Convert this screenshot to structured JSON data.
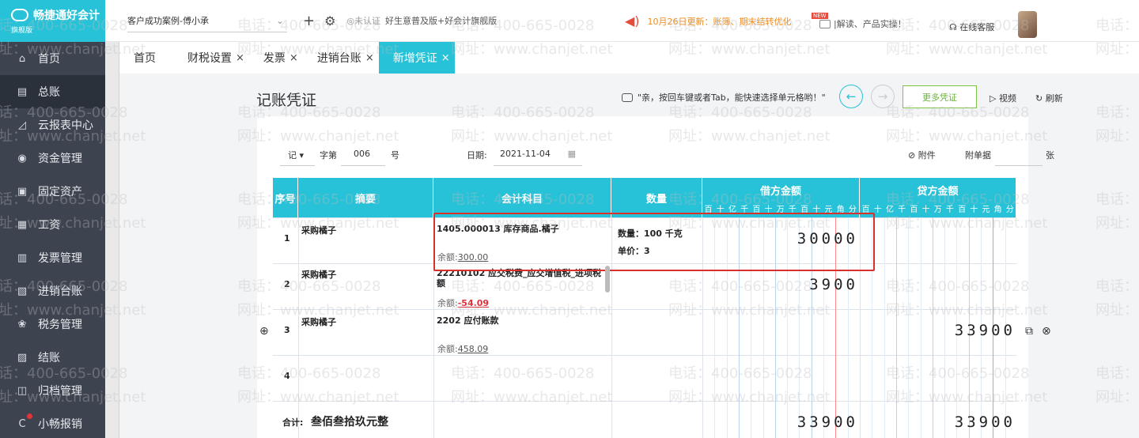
{
  "app": {
    "logo_text": "畅捷通好会计",
    "logo_sub": "旗舰版"
  },
  "sidebar": {
    "items": [
      {
        "label": "首页",
        "icon": "home-icon",
        "glyph": "⌂"
      },
      {
        "label": "总账",
        "icon": "ledger-icon",
        "glyph": "▤"
      },
      {
        "label": "云报表中心",
        "icon": "chart-icon",
        "glyph": "◿"
      },
      {
        "label": "资金管理",
        "icon": "money-bag-icon",
        "glyph": "◉"
      },
      {
        "label": "固定资产",
        "icon": "asset-icon",
        "glyph": "▣"
      },
      {
        "label": "工资",
        "icon": "salary-icon",
        "glyph": "▦"
      },
      {
        "label": "发票管理",
        "icon": "invoice-icon",
        "glyph": "▥"
      },
      {
        "label": "进销台账",
        "icon": "inventory-icon",
        "glyph": "▧"
      },
      {
        "label": "税务管理",
        "icon": "tax-icon",
        "glyph": "❀"
      },
      {
        "label": "结账",
        "icon": "checkout-icon",
        "glyph": "▨"
      },
      {
        "label": "归档管理",
        "icon": "archive-icon",
        "glyph": "◫"
      },
      {
        "label": "小畅报销",
        "icon": "reimburse-icon",
        "glyph": "C"
      }
    ],
    "active_index": 1
  },
  "topbar": {
    "company": "客户成功案例-傅小承",
    "auth": "未认证",
    "edition": "好生意普及版+好会计旗舰版",
    "notice": "10月26日更新：账簿、期末结转优化",
    "new_tag": "NEW",
    "promo": "|解读、产品实操！",
    "service": "在线客服"
  },
  "tabs": [
    {
      "label": "首页",
      "closable": false
    },
    {
      "label": "财税设置",
      "closable": true
    },
    {
      "label": "发票",
      "closable": true
    },
    {
      "label": "进销台账",
      "closable": true
    },
    {
      "label": "新增凭证",
      "closable": true,
      "active": true
    }
  ],
  "voucher": {
    "title": "记账凭证",
    "hint": "\"亲，按回车键或者Tab，能快速选择单元格哟！\"",
    "more_label": "更多凭证",
    "video_label": "视频",
    "refresh_label": "刷新",
    "type": "记",
    "zi_label": "字第",
    "number": "006",
    "hao_label": "号",
    "date_label": "日期:",
    "date": "2021-11-04",
    "attach_label": "附件",
    "attach_docs_label": "附单据",
    "zhang_label": "张",
    "headers": {
      "seq": "序号",
      "summary": "摘要",
      "account": "会计科目",
      "qty": "数量",
      "debit": "借方金额",
      "credit": "贷方金额",
      "digits": [
        "百",
        "十",
        "亿",
        "千",
        "百",
        "十",
        "万",
        "千",
        "百",
        "十",
        "元",
        "角",
        "分"
      ]
    },
    "rows": [
      {
        "seq": "1",
        "summary": "采购橘子",
        "account": "1405.000013 库存商品.橘子",
        "balance_label": "余额:",
        "balance": "300.00",
        "qty_line1": "数量：100 千克",
        "qty_line2": "单价：3",
        "debit": "30000",
        "credit": ""
      },
      {
        "seq": "2",
        "summary": "采购橘子",
        "account": "22210102 应交税费_应交增值税_进项税额",
        "balance_label": "余额:",
        "balance": "-54.09",
        "qty_line1": "",
        "qty_line2": "",
        "debit": "3900",
        "credit": ""
      },
      {
        "seq": "3",
        "summary": "采购橘子",
        "account": "2202 应付账款",
        "balance_label": "余额:",
        "balance": "458.09",
        "qty_line1": "",
        "qty_line2": "",
        "debit": "",
        "credit": "33900"
      },
      {
        "seq": "4",
        "summary": "",
        "account": "",
        "balance_label": "",
        "balance": "",
        "qty_line1": "",
        "qty_line2": "",
        "debit": "",
        "credit": ""
      }
    ],
    "total_label": "合计:",
    "total_words": "叁佰叁拾玖元整",
    "total_debit": "33900",
    "total_credit": "33900"
  },
  "watermark": {
    "phone": "电话：400-665-0028",
    "site": "网址：www.chanjet.net"
  }
}
